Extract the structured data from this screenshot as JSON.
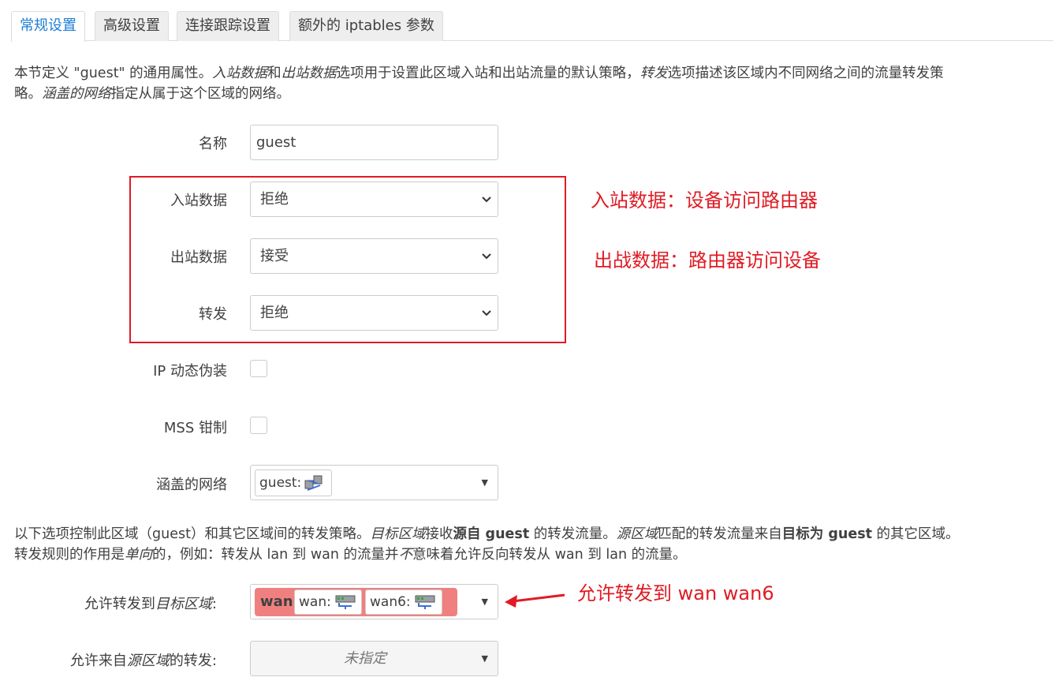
{
  "tabs": [
    "常规设置",
    "高级设置",
    "连接跟踪设置",
    "额外的 iptables 参数"
  ],
  "intro": {
    "p1": "本节定义 \"guest\" 的通用属性。",
    "i1": "入站数据",
    "p2": "和",
    "i2": "出站数据",
    "p3": "选项用于设置此区域入站和出站流量的默认策略，",
    "i3": "转发",
    "p4": "选项描述该区域内不同网络之间的流量转发策",
    "p5": "略。",
    "i4": "涵盖的网络",
    "p6": "指定从属于这个区域的网络。"
  },
  "fields": {
    "name_label": "名称",
    "name_value": "guest",
    "input_label": "入站数据",
    "input_value": "拒绝",
    "output_label": "出站数据",
    "output_value": "接受",
    "forward_label": "转发",
    "forward_value": "拒绝",
    "masq_label": "IP 动态伪装",
    "mss_label": "MSS 钳制",
    "networks_label": "涵盖的网络",
    "networks_chip": "guest:"
  },
  "forward_desc": {
    "p1": "以下选项控制此区域（guest）和其它区域间的转发策略。",
    "i1": "目标区域",
    "p2": "接收",
    "b1": "源自 guest",
    "p3": " 的转发流量。",
    "i2": "源区域",
    "p4": "匹配的转发流量来自",
    "b2": "目标为 guest",
    "p5": " 的其它区域。",
    "p6": "转发规则的作用是",
    "i3": "单向",
    "p7": "的，例如：转发从 lan 到 wan 的流量并",
    "i4": "不",
    "p8": "意味着允许反向转发从 wan 到 lan 的流量。"
  },
  "dest": {
    "label_prefix": "允许转发到",
    "label_italic": "目标区域",
    "label_suffix": ":",
    "zone_name": "wan",
    "chip1": "wan:",
    "chip2": "wan6:"
  },
  "src": {
    "label_prefix": "允许来自",
    "label_italic": "源区域",
    "label_suffix": "的转发:",
    "placeholder": "未指定"
  },
  "annotations": {
    "a1": "入站数据：设备访问路由器",
    "a2": "出战数据：路由器访问设备",
    "a3": "允许转发到 wan wan6"
  },
  "colors": {
    "accent": "#1e7dd6",
    "annotation": "#e01b24",
    "zone_wan": "#f08080"
  }
}
